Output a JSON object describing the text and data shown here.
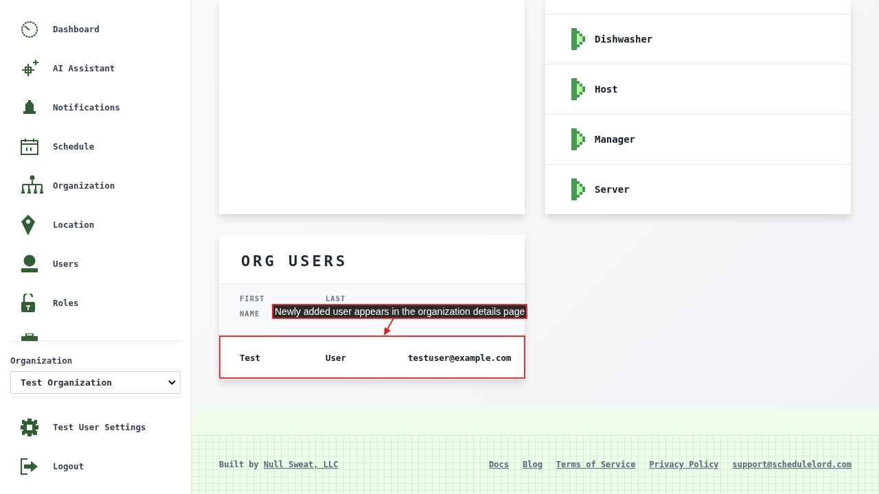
{
  "sidebar": {
    "items": [
      {
        "label": "Dashboard"
      },
      {
        "label": "AI Assistant"
      },
      {
        "label": "Notifications"
      },
      {
        "label": "Schedule"
      },
      {
        "label": "Organization"
      },
      {
        "label": "Location"
      },
      {
        "label": "Users"
      },
      {
        "label": "Roles"
      }
    ],
    "org_label": "Organization",
    "org_select": "Test Organization",
    "bottom_items": [
      {
        "label": "Test User Settings"
      },
      {
        "label": "Logout"
      }
    ]
  },
  "roles": [
    "Dishwasher",
    "Host",
    "Manager",
    "Server"
  ],
  "org_users": {
    "title": "ORG USERS",
    "columns": [
      "FIRST NAME",
      "LAST"
    ],
    "rows": [
      [
        "Test",
        "User",
        "testuser@example.com"
      ]
    ]
  },
  "annotation": "Newly added user appears in the organization details page",
  "footer": {
    "built_by": "Built by",
    "built_by_link": "Null Sweat, LLC",
    "links": [
      "Docs",
      "Blog",
      "Terms of Service",
      "Privacy Policy",
      "support@schedulelord.com"
    ]
  }
}
